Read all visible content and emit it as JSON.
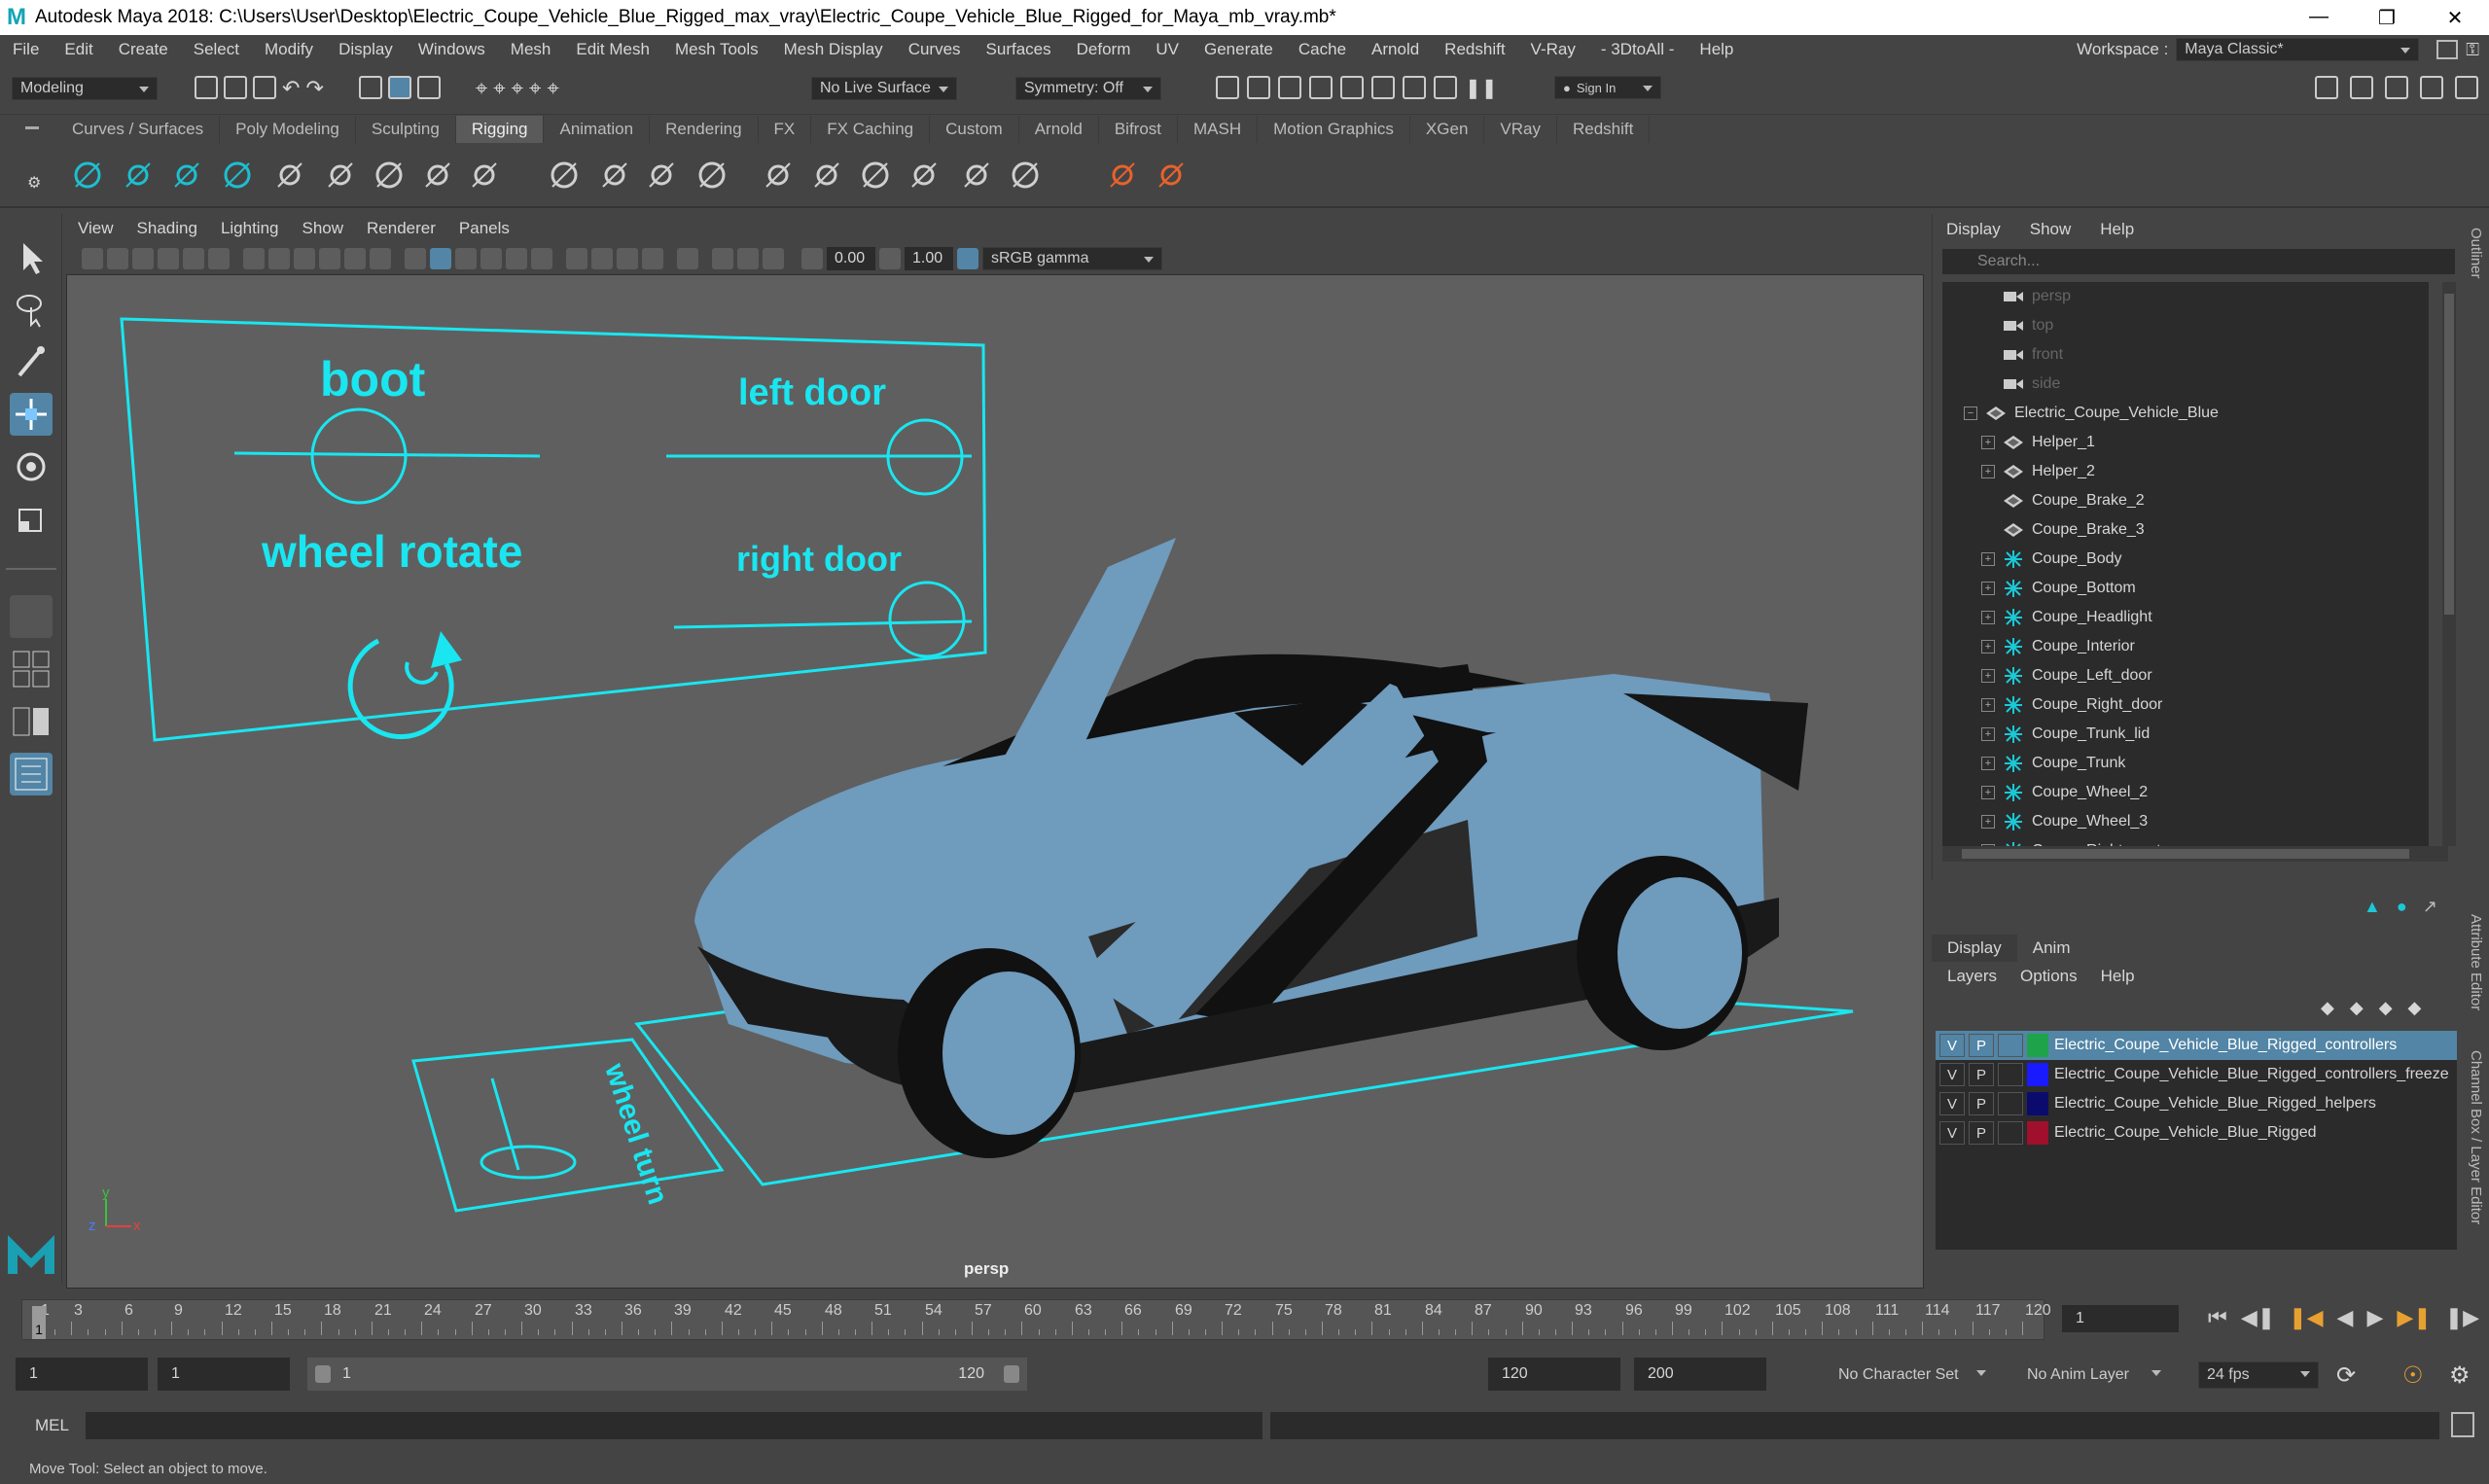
{
  "window": {
    "title": "Autodesk Maya 2018: C:\\Users\\User\\Desktop\\Electric_Coupe_Vehicle_Blue_Rigged_max_vray\\Electric_Coupe_Vehicle_Blue_Rigged_for_Maya_mb_vray.mb*",
    "logo": "M"
  },
  "menus": [
    "File",
    "Edit",
    "Create",
    "Select",
    "Modify",
    "Display",
    "Windows",
    "Mesh",
    "Edit Mesh",
    "Mesh Tools",
    "Mesh Display",
    "Curves",
    "Surfaces",
    "Deform",
    "UV",
    "Generate",
    "Cache",
    "Arnold",
    "Redshift",
    "V-Ray",
    "- 3DtoAll -",
    "Help"
  ],
  "workspace": {
    "label": "Workspace :",
    "value": "Maya Classic*"
  },
  "status": {
    "mode": "Modeling",
    "live_surface": "No Live Surface",
    "symmetry": "Symmetry: Off",
    "signin": "Sign In"
  },
  "shelf_tabs": [
    "Curves / Surfaces",
    "Poly Modeling",
    "Sculpting",
    "Rigging",
    "Animation",
    "Rendering",
    "FX",
    "FX Caching",
    "Custom",
    "Arnold",
    "Bifrost",
    "MASH",
    "Motion Graphics",
    "XGen",
    "VRay",
    "Redshift"
  ],
  "shelf_active": "Rigging",
  "viewport": {
    "menus": [
      "View",
      "Shading",
      "Lighting",
      "Show",
      "Renderer",
      "Panels"
    ],
    "exposure": "0.00",
    "gamma": "1.00",
    "colorspace": "sRGB gamma",
    "camera": "persp",
    "controls": {
      "boot": "boot",
      "left_door": "left door",
      "wheel_rotate": "wheel rotate",
      "right_door": "right door",
      "wheel_turn": "wheel turn"
    },
    "axis": {
      "x": "x",
      "y": "y",
      "z": "z"
    }
  },
  "outliner": {
    "menus": [
      "Display",
      "Show",
      "Help"
    ],
    "search_placeholder": "Search...",
    "cameras": [
      "persp",
      "top",
      "front",
      "side"
    ],
    "root": "Electric_Coupe_Vehicle_Blue",
    "children": [
      {
        "name": "Helper_1",
        "icon": "transform-icon",
        "expand": true
      },
      {
        "name": "Helper_2",
        "icon": "transform-icon",
        "expand": true
      },
      {
        "name": "Coupe_Brake_2",
        "icon": "transform-icon",
        "expand": false
      },
      {
        "name": "Coupe_Brake_3",
        "icon": "transform-icon",
        "expand": false
      },
      {
        "name": "Coupe_Body",
        "icon": "joint-icon",
        "expand": true
      },
      {
        "name": "Coupe_Bottom",
        "icon": "joint-icon",
        "expand": true
      },
      {
        "name": "Coupe_Headlight",
        "icon": "joint-icon",
        "expand": true
      },
      {
        "name": "Coupe_Interior",
        "icon": "joint-icon",
        "expand": true
      },
      {
        "name": "Coupe_Left_door",
        "icon": "joint-icon",
        "expand": true
      },
      {
        "name": "Coupe_Right_door",
        "icon": "joint-icon",
        "expand": true
      },
      {
        "name": "Coupe_Trunk_lid",
        "icon": "joint-icon",
        "expand": true
      },
      {
        "name": "Coupe_Trunk",
        "icon": "joint-icon",
        "expand": true
      },
      {
        "name": "Coupe_Wheel_2",
        "icon": "joint-icon",
        "expand": true
      },
      {
        "name": "Coupe_Wheel_3",
        "icon": "joint-icon",
        "expand": true
      },
      {
        "name": "Coupe_Right_seat",
        "icon": "joint-icon",
        "expand": true
      }
    ]
  },
  "layers": {
    "tabs": [
      "Display",
      "Anim"
    ],
    "menus": [
      "Layers",
      "Options",
      "Help"
    ],
    "rows": [
      {
        "v": "V",
        "p": "P",
        "name": "Electric_Coupe_Vehicle_Blue_Rigged_controllers",
        "color": "#1fa34a",
        "selected": true
      },
      {
        "v": "V",
        "p": "P",
        "name": "Electric_Coupe_Vehicle_Blue_Rigged_controllers_freeze",
        "color": "#1a1aff",
        "selected": false
      },
      {
        "v": "V",
        "p": "P",
        "name": "Electric_Coupe_Vehicle_Blue_Rigged_helpers",
        "color": "#0b0b6e",
        "selected": false
      },
      {
        "v": "V",
        "p": "P",
        "name": "Electric_Coupe_Vehicle_Blue_Rigged",
        "color": "#a0102c",
        "selected": false
      }
    ]
  },
  "side_tabs": [
    "Outliner",
    "Attribute Editor",
    "Channel Box / Layer Editor"
  ],
  "timeline": {
    "ticks": [
      "1",
      "3",
      "6",
      "9",
      "12",
      "15",
      "18",
      "21",
      "24",
      "27",
      "30",
      "33",
      "36",
      "39",
      "42",
      "45",
      "48",
      "51",
      "54",
      "57",
      "60",
      "63",
      "66",
      "69",
      "72",
      "75",
      "78",
      "81",
      "84",
      "87",
      "90",
      "93",
      "96",
      "99",
      "102",
      "105",
      "108",
      "111",
      "114",
      "117",
      "120"
    ],
    "current": "1",
    "current_marker": "1"
  },
  "range": {
    "start": "1",
    "playback_start": "1",
    "slider_start": "1",
    "slider_end": "120",
    "playback_end": "120",
    "end": "200",
    "character_set": "No Character Set",
    "anim_layer": "No Anim Layer",
    "fps": "24 fps"
  },
  "mel": {
    "label": "MEL"
  },
  "help": "Move Tool: Select an object to move."
}
